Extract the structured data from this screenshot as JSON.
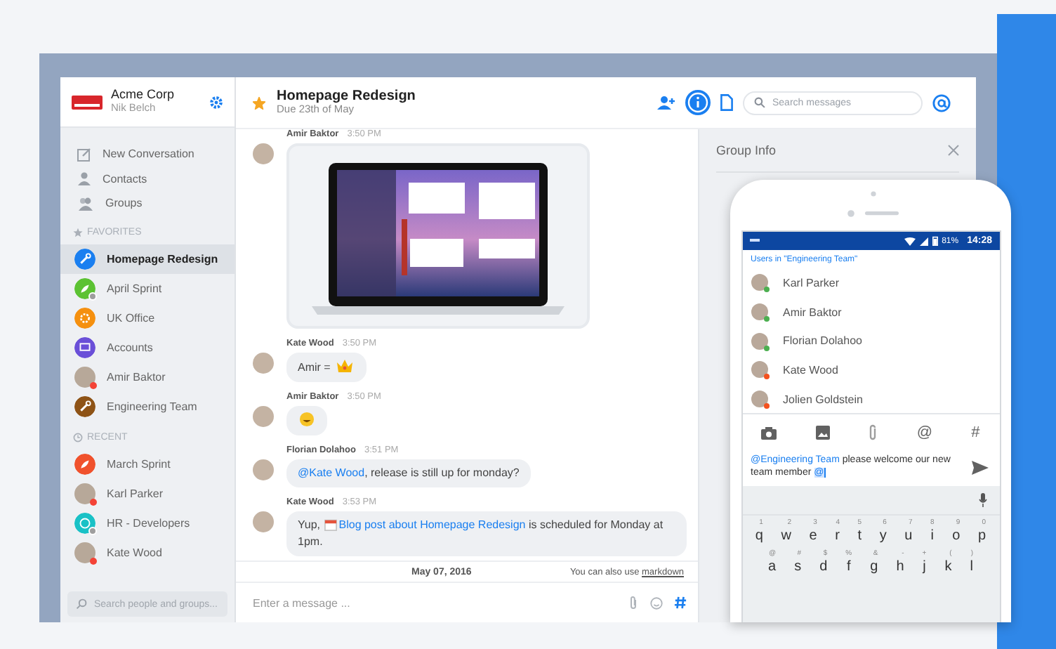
{
  "sidebar": {
    "workspace": "Acme Corp",
    "user": "Nik Belch",
    "nav": [
      {
        "label": "New Conversation"
      },
      {
        "label": "Contacts"
      },
      {
        "label": "Groups"
      }
    ],
    "sections": [
      {
        "heading": "FAVORITES",
        "items": [
          {
            "name": "Homepage Redesign",
            "selected": true,
            "kind": "wrench",
            "color": "#1a7ff0",
            "busy": false,
            "group_badge": false
          },
          {
            "name": "April Sprint",
            "selected": false,
            "kind": "rocket",
            "color": "#5cc233",
            "busy": false,
            "group_badge": true
          },
          {
            "name": "UK Office",
            "selected": false,
            "kind": "flower",
            "color": "#f5900f",
            "busy": false,
            "group_badge": false
          },
          {
            "name": "Accounts",
            "selected": false,
            "kind": "screen",
            "color": "#6a4fd8",
            "busy": false,
            "group_badge": false
          },
          {
            "name": "Amir Baktor",
            "selected": false,
            "kind": "photo",
            "busy": true,
            "group_badge": false
          },
          {
            "name": "Engineering Team",
            "selected": false,
            "kind": "wrench",
            "color": "#8e5316",
            "busy": false,
            "group_badge": false
          }
        ]
      },
      {
        "heading": "RECENT",
        "items": [
          {
            "name": "March Sprint",
            "selected": false,
            "kind": "rocket",
            "color": "#f0512c",
            "busy": false,
            "group_badge": false
          },
          {
            "name": "Karl Parker",
            "selected": false,
            "kind": "photo",
            "busy": true,
            "group_badge": false
          },
          {
            "name": "HR - Developers",
            "selected": false,
            "kind": "smile",
            "color": "#19c1c6",
            "busy": false,
            "group_badge": true
          },
          {
            "name": "Kate Wood",
            "selected": false,
            "kind": "photo",
            "busy": true,
            "group_badge": false
          }
        ]
      }
    ],
    "search": {
      "placeholder": "Search people and groups..."
    }
  },
  "header": {
    "starred": true,
    "title": "Homepage Redesign",
    "subtitle": "Due 23th of May",
    "info_selected": true,
    "search": {
      "placeholder": "Search messages"
    }
  },
  "messages": [
    {
      "author": "Amir Baktor",
      "time": "3:50 PM",
      "kind": "image"
    },
    {
      "author": "Kate Wood",
      "time": "3:50 PM",
      "kind": "text",
      "parts": [
        {
          "kind": "text",
          "text": "Amir = "
        },
        {
          "kind": "crown"
        }
      ]
    },
    {
      "author": "Amir Baktor",
      "time": "3:50 PM",
      "kind": "text",
      "parts": [
        {
          "kind": "smile"
        }
      ]
    },
    {
      "author": "Florian Dolahoo",
      "time": "3:51 PM",
      "kind": "text",
      "parts": [
        {
          "kind": "link",
          "text": "@Kate Wood"
        },
        {
          "kind": "text",
          "text": ", release is still up for monday?"
        }
      ]
    },
    {
      "author": "Kate Wood",
      "time": "3:53 PM",
      "kind": "text",
      "parts": [
        {
          "kind": "text",
          "text": "Yup, "
        },
        {
          "kind": "calendar"
        },
        {
          "kind": "link",
          "text": "Blog post about Homepage Redesign"
        },
        {
          "kind": "text",
          "text": " is scheduled for Monday at 1pm."
        }
      ]
    }
  ],
  "divider": {
    "date": "May 07, 2016",
    "hint": "You can also use",
    "link": "markdown"
  },
  "composer": {
    "placeholder": "Enter a message ..."
  },
  "group_info": {
    "title": "Group Info"
  },
  "phone": {
    "battery": "81%",
    "time": "14:28",
    "heading": "Users in \"Engineering Team\"",
    "users": [
      {
        "name": "Karl Parker",
        "color": "#4caf50"
      },
      {
        "name": "Amir Baktor",
        "color": "#4caf50"
      },
      {
        "name": "Florian Dolahoo",
        "color": "#4caf50"
      },
      {
        "name": "Kate Wood",
        "color": "#f4511e"
      },
      {
        "name": "Jolien Goldstein",
        "color": "#f4511e"
      }
    ],
    "tools": [
      {
        "kind": "camera"
      },
      {
        "kind": "image"
      },
      {
        "kind": "clip"
      },
      {
        "kind": "char",
        "text": "@"
      },
      {
        "kind": "char",
        "text": "#"
      }
    ],
    "message": [
      {
        "kind": "link",
        "text": "@Engineering Team"
      },
      {
        "kind": "text",
        "text": " please welcome our new team member "
      },
      {
        "kind": "mention",
        "text": "@"
      }
    ],
    "keyboard": [
      [
        {
          "key": "q",
          "hint": "1"
        },
        {
          "key": "w",
          "hint": "2"
        },
        {
          "key": "e",
          "hint": "3"
        },
        {
          "key": "r",
          "hint": "4"
        },
        {
          "key": "t",
          "hint": "5"
        },
        {
          "key": "y",
          "hint": "6"
        },
        {
          "key": "u",
          "hint": "7"
        },
        {
          "key": "i",
          "hint": "8"
        },
        {
          "key": "o",
          "hint": "9"
        },
        {
          "key": "p",
          "hint": "0"
        }
      ],
      [
        {
          "key": "a",
          "hint": "@"
        },
        {
          "key": "s",
          "hint": "#"
        },
        {
          "key": "d",
          "hint": "$"
        },
        {
          "key": "f",
          "hint": "%"
        },
        {
          "key": "g",
          "hint": "&"
        },
        {
          "key": "h",
          "hint": "-"
        },
        {
          "key": "j",
          "hint": "+"
        },
        {
          "key": "k",
          "hint": "("
        },
        {
          "key": "l",
          "hint": ")"
        }
      ]
    ]
  }
}
